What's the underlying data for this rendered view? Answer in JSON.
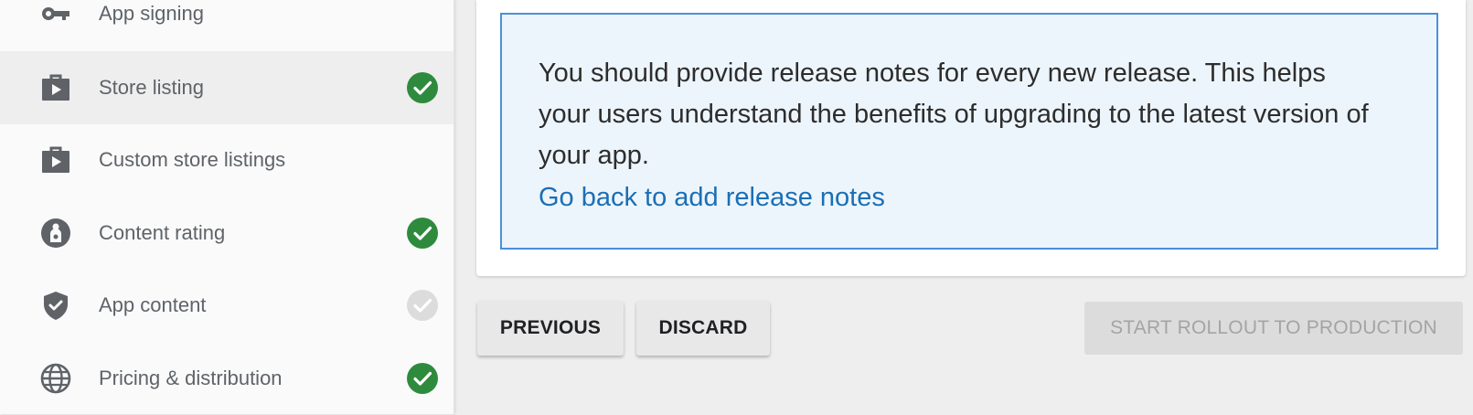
{
  "sidebar": {
    "items": [
      {
        "label": "App signing",
        "icon": "key-icon",
        "status": "none"
      },
      {
        "label": "Store listing",
        "icon": "store-bag-icon",
        "status": "complete"
      },
      {
        "label": "Custom store listings",
        "icon": "store-bag-icon",
        "status": "none"
      },
      {
        "label": "Content rating",
        "icon": "content-rating-icon",
        "status": "complete"
      },
      {
        "label": "App content",
        "icon": "shield-icon",
        "status": "incomplete"
      },
      {
        "label": "Pricing & distribution",
        "icon": "globe-icon",
        "status": "complete"
      }
    ],
    "selected": "Store listing"
  },
  "notice": {
    "message": "You should provide release notes for every new release. This helps your users understand the benefits of upgrading to the latest version of your app.",
    "link_label": "Go back to add release notes"
  },
  "actions": {
    "previous_label": "PREVIOUS",
    "discard_label": "DISCARD",
    "rollout_label": "START ROLLOUT TO PRODUCTION"
  },
  "colors": {
    "accent": "#1a6fb5",
    "success": "#2e8b3e",
    "info_background": "#edf5fc",
    "info_border": "#4a90d9",
    "disabled_check": "#dcdcdc"
  }
}
